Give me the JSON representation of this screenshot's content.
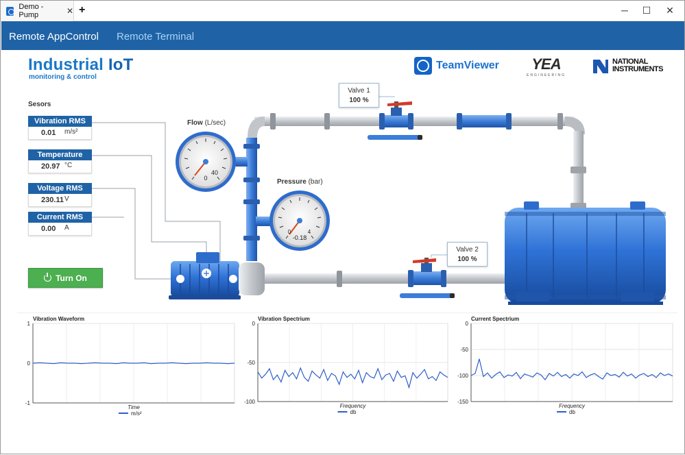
{
  "browser": {
    "tab_title": "Demo - Pump",
    "tab_close": "✕",
    "new_tab": "+",
    "min_icon": "─",
    "max_icon": "☐",
    "close_icon": "✕"
  },
  "nav": {
    "items": [
      {
        "label": "Remote AppControl",
        "active": true
      },
      {
        "label": "Remote Terminal",
        "active": false
      }
    ]
  },
  "header": {
    "title_part1": "Industrial ",
    "title_part2": "IoT",
    "subtitle": "monitoring & control",
    "logos": {
      "teamviewer": "TeamViewer",
      "yea": "YEA",
      "yea_sub": "ENGINEERING",
      "ni_line1": "NATIONAL",
      "ni_line2": "INSTRUMENTS"
    }
  },
  "sensors": {
    "title": "Sesors",
    "items": [
      {
        "label": "Vibration RMS",
        "value": "0.01",
        "unit": "m/s²"
      },
      {
        "label": "Temperature",
        "value": "20.97",
        "unit": "°C"
      },
      {
        "label": "Voltage RMS",
        "value": "230.11",
        "unit": "V"
      },
      {
        "label": "Current RMS",
        "value": "0.00",
        "unit": "A"
      }
    ]
  },
  "controls": {
    "turn_on_label": "Turn On",
    "power_icon": "power-icon"
  },
  "gauges": {
    "flow": {
      "label": "Flow",
      "unit": "(L/sec)",
      "min_label": "0",
      "max_label": "40",
      "value": 0
    },
    "pressure": {
      "label": "Pressure",
      "unit": "(bar)",
      "min_label": "0",
      "max_label": "4",
      "value": "-0.18"
    }
  },
  "valves": {
    "valve1": {
      "name": "Valve 1",
      "value": "100 %"
    },
    "valve2": {
      "name": "Valve 2",
      "value": "100 %"
    }
  },
  "colors": {
    "primary": "#1f63a6",
    "pipe_blue": "#3b7dd8",
    "pipe_gray": "#c9ccd0",
    "button_green": "#4caf50",
    "chart_line": "#2d5fc8"
  },
  "chart_data": [
    {
      "type": "line",
      "title": "Vibration Waveform",
      "xlabel": "Time",
      "ylabel": "",
      "ylim": [
        -1,
        1
      ],
      "y_ticks": [
        "1",
        "0",
        "-1"
      ],
      "grid": true,
      "legend": "bottom",
      "series": [
        {
          "name": "m/s²",
          "values": [
            0.0,
            0.01,
            0.0,
            -0.01,
            0.01,
            0.0,
            0.0,
            -0.01,
            0.0,
            0.01,
            0.0,
            0.0,
            -0.01,
            0.01,
            0.0,
            0.0,
            0.01,
            -0.01,
            0.0,
            0.0,
            0.01,
            0.0,
            -0.01,
            0.0,
            0.0,
            0.01,
            0.0,
            0.0,
            -0.01,
            0.0
          ]
        }
      ]
    },
    {
      "type": "line",
      "title": "Vibration Spectrium",
      "xlabel": "Frequency",
      "ylabel": "",
      "ylim": [
        -100,
        0
      ],
      "y_ticks": [
        "0",
        "-50",
        "-100"
      ],
      "grid": true,
      "legend": "bottom",
      "series": [
        {
          "name": "db",
          "values": [
            -62,
            -70,
            -65,
            -58,
            -72,
            -66,
            -75,
            -60,
            -68,
            -63,
            -71,
            -57,
            -69,
            -74,
            -61,
            -66,
            -70,
            -59,
            -73,
            -64,
            -67,
            -78,
            -62,
            -69,
            -65,
            -71,
            -60,
            -76,
            -63,
            -68,
            -70,
            -58,
            -72,
            -66,
            -64,
            -74,
            -61,
            -69,
            -67,
            -82,
            -63,
            -70,
            -65,
            -59,
            -71,
            -68,
            -73,
            -62,
            -66,
            -69
          ]
        }
      ]
    },
    {
      "type": "line",
      "title": "Current Spectrium",
      "xlabel": "Frequency",
      "ylabel": "",
      "ylim": [
        -150,
        0
      ],
      "y_ticks": [
        "0",
        "-50",
        "-100",
        "-150"
      ],
      "grid": true,
      "legend": "bottom",
      "series": [
        {
          "name": "db",
          "values": [
            -100,
            -96,
            -68,
            -102,
            -95,
            -105,
            -98,
            -93,
            -104,
            -99,
            -101,
            -94,
            -106,
            -97,
            -100,
            -103,
            -95,
            -99,
            -108,
            -96,
            -101,
            -94,
            -102,
            -98,
            -105,
            -97,
            -100,
            -93,
            -104,
            -99,
            -96,
            -102,
            -107,
            -95,
            -100,
            -98,
            -103,
            -94,
            -101,
            -97,
            -105,
            -99,
            -96,
            -102,
            -98,
            -104,
            -95,
            -100,
            -97,
            -101
          ]
        }
      ]
    }
  ]
}
